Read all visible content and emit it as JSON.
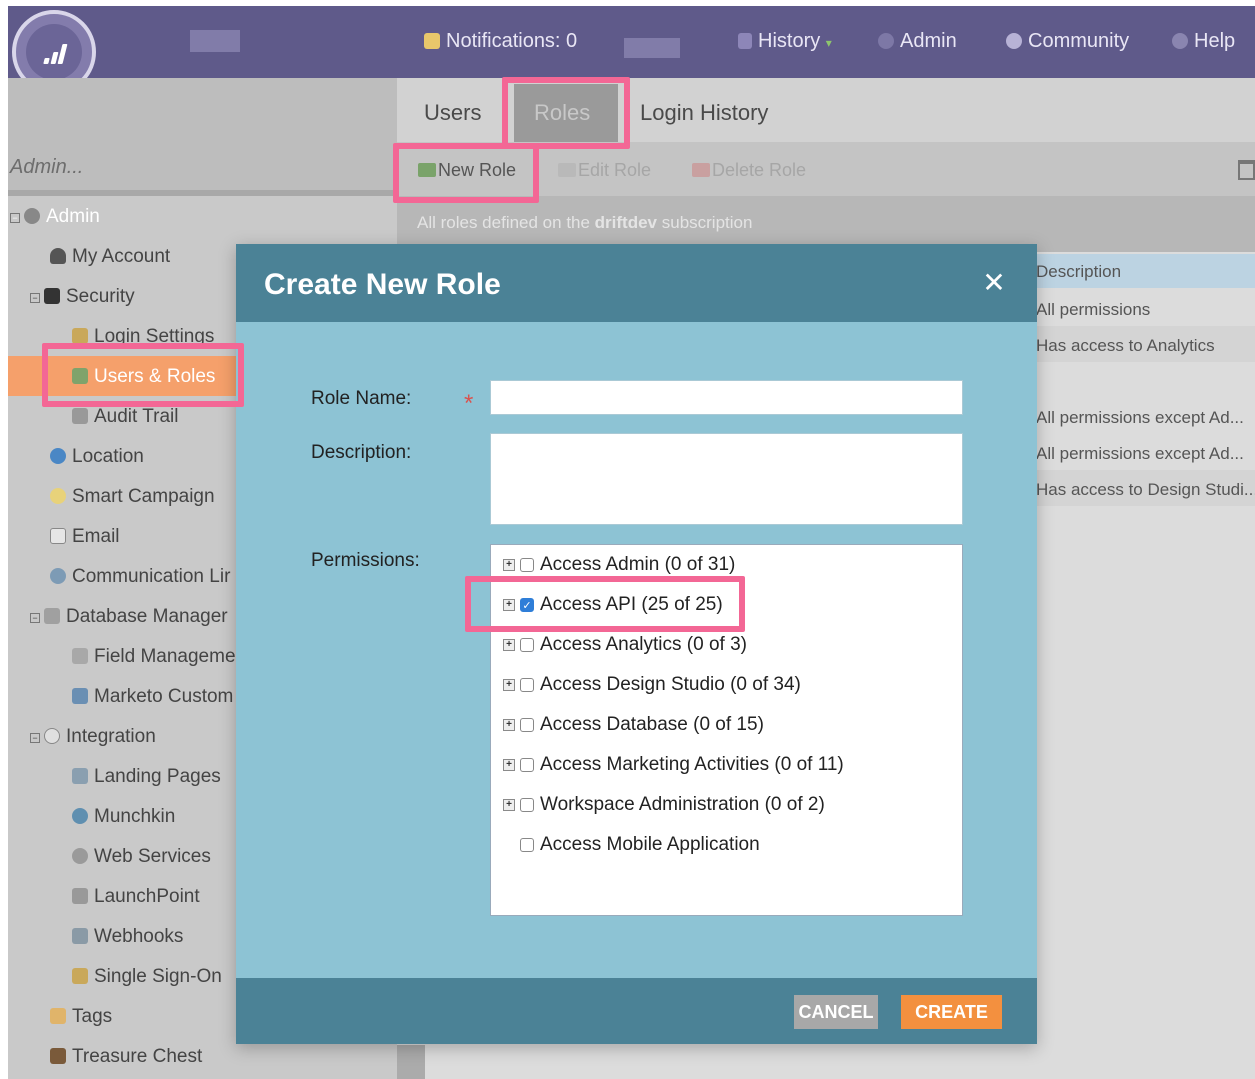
{
  "header": {
    "notifications_label": "Notifications: 0",
    "history_label": "History",
    "admin_label": "Admin",
    "community_label": "Community",
    "help_label": "Help"
  },
  "sidebar": {
    "title": "Admin...",
    "items": [
      {
        "label": "Admin",
        "icon": "gear-icon"
      },
      {
        "label": "My Account",
        "icon": "user-icon"
      },
      {
        "label": "Security",
        "icon": "lock-icon"
      },
      {
        "label": "Login Settings",
        "icon": "key-icon"
      },
      {
        "label": "Users & Roles",
        "icon": "users-icon"
      },
      {
        "label": "Audit Trail",
        "icon": "audit-icon"
      },
      {
        "label": "Location",
        "icon": "globe-icon"
      },
      {
        "label": "Smart Campaign",
        "icon": "lightbulb-icon"
      },
      {
        "label": "Email",
        "icon": "email-icon"
      },
      {
        "label": "Communication Lir",
        "icon": "at-icon"
      },
      {
        "label": "Database Manager",
        "icon": "database-icon"
      },
      {
        "label": "Field Manageme",
        "icon": "field-icon"
      },
      {
        "label": "Marketo Custom",
        "icon": "custom-object-icon"
      },
      {
        "label": "Integration",
        "icon": "cloud-icon"
      },
      {
        "label": "Landing Pages",
        "icon": "landing-page-icon"
      },
      {
        "label": "Munchkin",
        "icon": "munchkin-icon"
      },
      {
        "label": "Web Services",
        "icon": "web-services-icon"
      },
      {
        "label": "LaunchPoint",
        "icon": "rocket-icon"
      },
      {
        "label": "Webhooks",
        "icon": "webhook-icon"
      },
      {
        "label": "Single Sign-On",
        "icon": "sso-key-icon"
      },
      {
        "label": "Tags",
        "icon": "tag-icon"
      },
      {
        "label": "Treasure Chest",
        "icon": "chest-icon"
      }
    ]
  },
  "tabs": {
    "users": "Users",
    "roles": "Roles",
    "login_history": "Login History"
  },
  "toolbar": {
    "new_role": "New Role",
    "edit_role": "Edit Role",
    "delete_role": "Delete Role"
  },
  "subinfo": {
    "prefix": "All roles defined on the ",
    "subscription": "driftdev",
    "suffix": " subscription"
  },
  "grid": {
    "header": "Description",
    "rows": [
      "All permissions",
      "Has access to Analytics",
      "",
      "All permissions except Ad...",
      "All permissions except Ad...",
      "Has access to Design Studi..."
    ]
  },
  "modal": {
    "title": "Create New Role",
    "close_glyph": "✕",
    "role_name_label": "Role Name:",
    "required_mark": "*",
    "role_name_value": "",
    "description_label": "Description:",
    "description_value": "",
    "permissions_label": "Permissions:",
    "permissions": [
      {
        "label": "Access Admin (0 of 31)",
        "checked": false,
        "expandable": true
      },
      {
        "label": "Access API (25 of 25)",
        "checked": true,
        "expandable": true
      },
      {
        "label": "Access Analytics (0 of 3)",
        "checked": false,
        "expandable": true
      },
      {
        "label": "Access Design Studio (0 of 34)",
        "checked": false,
        "expandable": true
      },
      {
        "label": "Access Database (0 of 15)",
        "checked": false,
        "expandable": true
      },
      {
        "label": "Access Marketing Activities (0 of 11)",
        "checked": false,
        "expandable": true
      },
      {
        "label": "Workspace Administration (0 of 2)",
        "checked": false,
        "expandable": true
      },
      {
        "label": "Access Mobile Application",
        "checked": false,
        "expandable": false
      }
    ],
    "cancel_label": "CANCEL",
    "create_label": "CREATE"
  },
  "colors": {
    "header_bg": "#5f5a8a",
    "modal_head": "#4b8296",
    "modal_body": "#8dc3d4",
    "highlight": "#f36795",
    "create_button": "#f3903f",
    "active_nav": "#f5a06b"
  }
}
